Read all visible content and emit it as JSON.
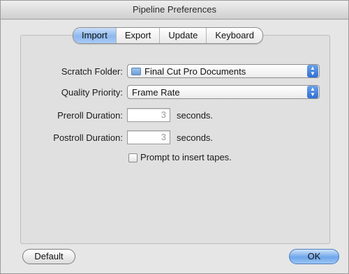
{
  "window": {
    "title": "Pipeline Preferences"
  },
  "tabs": [
    {
      "label": "Import",
      "active": true
    },
    {
      "label": "Export",
      "active": false
    },
    {
      "label": "Update",
      "active": false
    },
    {
      "label": "Keyboard",
      "active": false
    }
  ],
  "form": {
    "scratch_folder": {
      "label": "Scratch Folder:",
      "value": "Final Cut Pro Documents",
      "icon": "folder-icon"
    },
    "quality_priority": {
      "label": "Quality Priority:",
      "value": "Frame Rate"
    },
    "preroll": {
      "label": "Preroll Duration:",
      "value": "3",
      "unit": "seconds."
    },
    "postroll": {
      "label": "Postroll Duration:",
      "value": "3",
      "unit": "seconds."
    },
    "prompt_tapes": {
      "label": "Prompt to insert tapes.",
      "checked": false
    }
  },
  "buttons": {
    "default_label": "Default",
    "ok_label": "OK"
  },
  "colors": {
    "accent": "#6ea6ea",
    "tab_active": "#8db7ee"
  }
}
